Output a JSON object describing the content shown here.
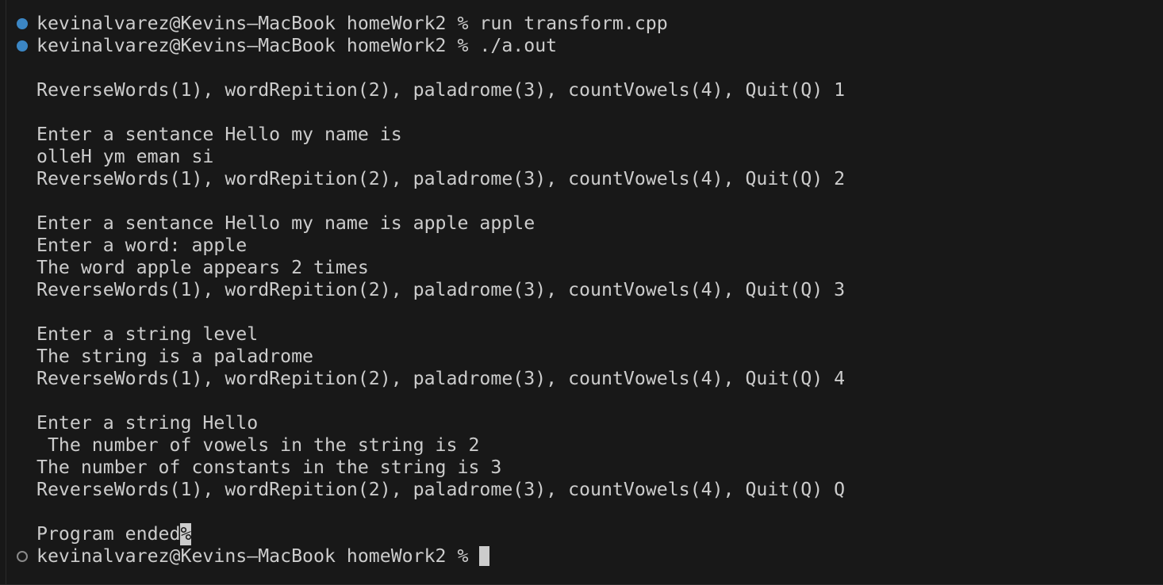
{
  "terminal": {
    "colors": {
      "background": "#181818",
      "text": "#cccccc",
      "success_marker": "#3b86c4",
      "pending_marker": "#8a8a8a"
    },
    "lines": [
      {
        "prompt_marker": "success",
        "text": "kevinalvarez@Kevins–MacBook homeWork2 % run transform.cpp"
      },
      {
        "prompt_marker": "success",
        "text": "kevinalvarez@Kevins–MacBook homeWork2 % ./a.out"
      },
      {
        "text": ""
      },
      {
        "text": "ReverseWords(1), wordRepition(2), paladrome(3), countVowels(4), Quit(Q) 1"
      },
      {
        "text": ""
      },
      {
        "text": "Enter a sentance Hello my name is"
      },
      {
        "text": "olleH ym eman si"
      },
      {
        "text": "ReverseWords(1), wordRepition(2), paladrome(3), countVowels(4), Quit(Q) 2"
      },
      {
        "text": ""
      },
      {
        "text": "Enter a sentance Hello my name is apple apple"
      },
      {
        "text": "Enter a word: apple"
      },
      {
        "text": "The word apple appears 2 times"
      },
      {
        "text": "ReverseWords(1), wordRepition(2), paladrome(3), countVowels(4), Quit(Q) 3"
      },
      {
        "text": ""
      },
      {
        "text": "Enter a string level"
      },
      {
        "text": "The string is a paladrome"
      },
      {
        "text": "ReverseWords(1), wordRepition(2), paladrome(3), countVowels(4), Quit(Q) 4"
      },
      {
        "text": ""
      },
      {
        "text": "Enter a string Hello"
      },
      {
        "text": " The number of vowels in the string is 2"
      },
      {
        "text": "The number of constants in the string is 3"
      },
      {
        "text": "ReverseWords(1), wordRepition(2), paladrome(3), countVowels(4), Quit(Q) Q"
      },
      {
        "text": ""
      },
      {
        "text": "Program ended",
        "end_marker": "%"
      },
      {
        "prompt_marker": "pending",
        "text": "kevinalvarez@Kevins–MacBook homeWork2 % ",
        "cursor": true
      }
    ]
  }
}
